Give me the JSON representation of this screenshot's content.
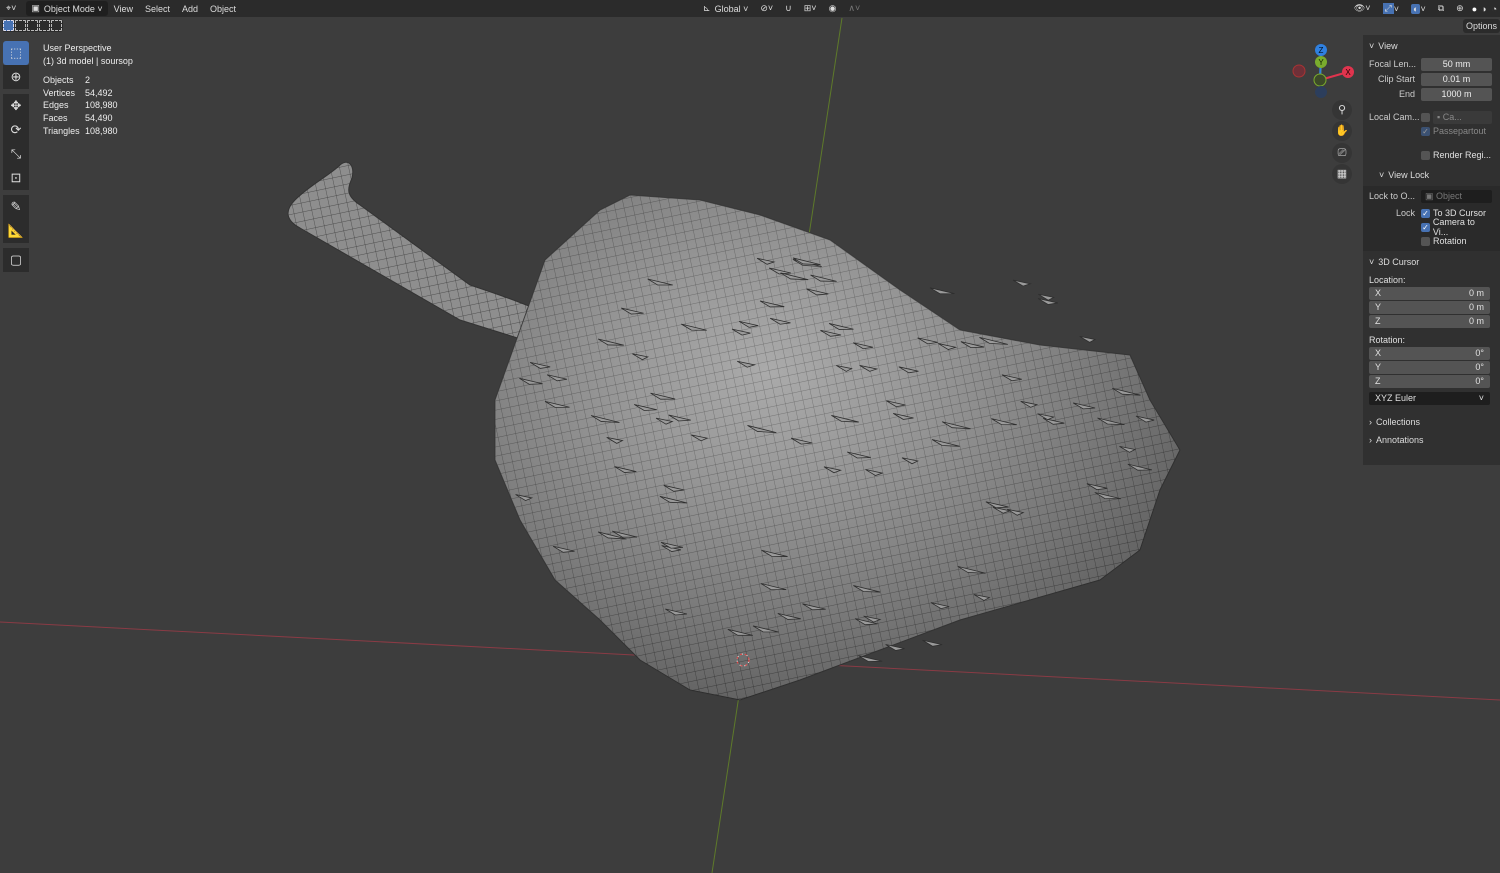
{
  "header": {
    "mode": "Object Mode",
    "menus": [
      "View",
      "Select",
      "Add",
      "Object"
    ],
    "orientation": "Global"
  },
  "options_label": "Options",
  "overlay": {
    "view_name": "User Perspective",
    "object_info": "(1) 3d model | soursop",
    "stats": [
      {
        "label": "Objects",
        "value": "2"
      },
      {
        "label": "Vertices",
        "value": "54,492"
      },
      {
        "label": "Edges",
        "value": "108,980"
      },
      {
        "label": "Faces",
        "value": "54,490"
      },
      {
        "label": "Triangles",
        "value": "108,980"
      }
    ]
  },
  "gizmo": {
    "x": "X",
    "y": "Y",
    "z": "Z",
    "colors": {
      "x": "#e0344e",
      "y": "#7aac2d",
      "z": "#2f80e0"
    }
  },
  "npanel": {
    "view": {
      "title": "View",
      "focal_label": "Focal Len...",
      "focal": "50 mm",
      "clip_start_label": "Clip Start",
      "clip_start": "0.01 m",
      "end_label": "End",
      "end": "1000 m",
      "local_cam_label": "Local Cam...",
      "local_cam_value": "Ca...",
      "passepartout": "Passepartout",
      "render_region": "Render Regi..."
    },
    "view_lock": {
      "title": "View Lock",
      "lock_to_label": "Lock to O...",
      "lock_to_placeholder": "Object",
      "lock_label": "Lock",
      "to_cursor": "To 3D Cursor",
      "camera_to_view": "Camera to Vi...",
      "rotation": "Rotation"
    },
    "cursor": {
      "title": "3D Cursor",
      "location_label": "Location:",
      "loc": [
        {
          "axis": "X",
          "value": "0 m"
        },
        {
          "axis": "Y",
          "value": "0 m"
        },
        {
          "axis": "Z",
          "value": "0 m"
        }
      ],
      "rotation_label": "Rotation:",
      "rot": [
        {
          "axis": "X",
          "value": "0°"
        },
        {
          "axis": "Y",
          "value": "0°"
        },
        {
          "axis": "Z",
          "value": "0°"
        }
      ],
      "rotation_mode": "XYZ Euler"
    },
    "collections": "Collections",
    "annotations": "Annotations"
  }
}
